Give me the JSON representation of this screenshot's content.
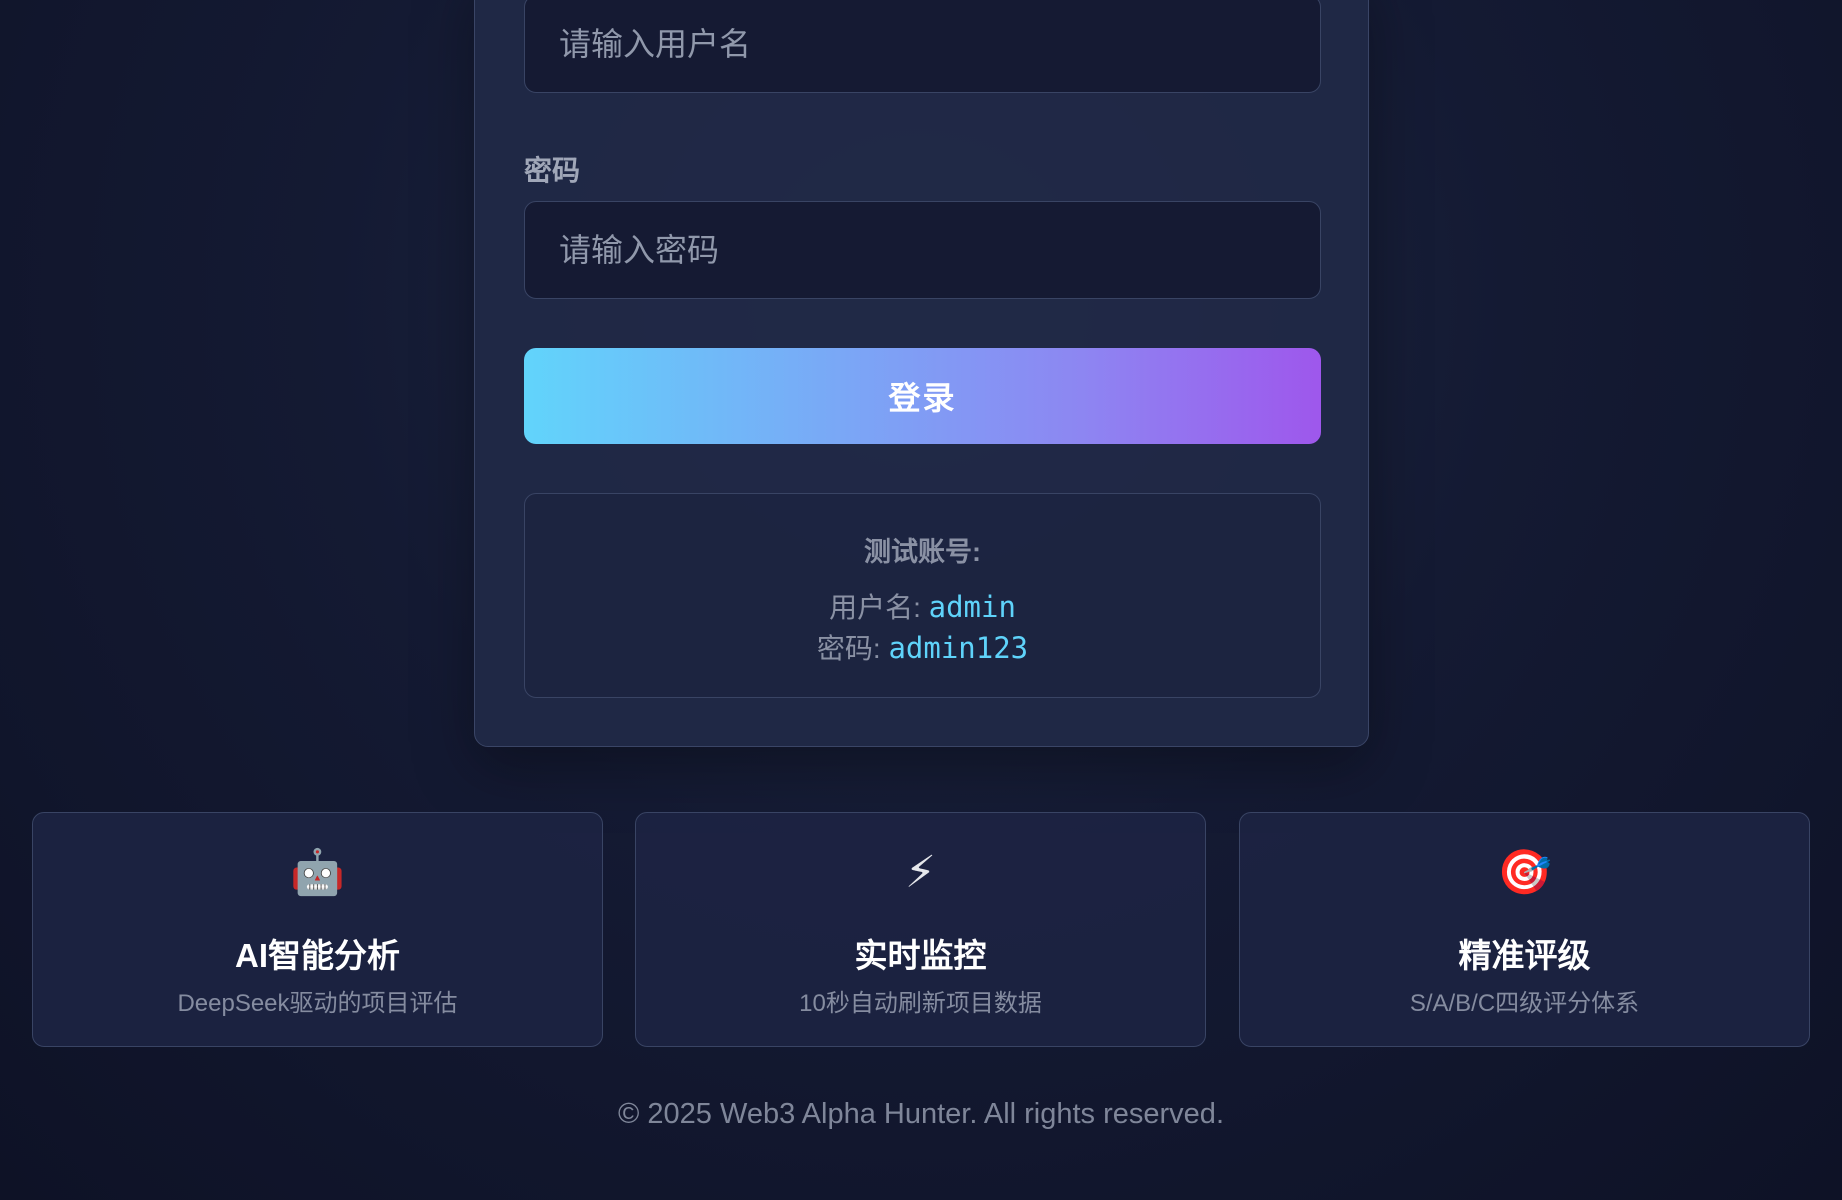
{
  "login": {
    "username_placeholder": "请输入用户名",
    "password_label": "密码",
    "password_placeholder": "请输入密码",
    "login_button": "登录"
  },
  "test_account": {
    "title": "测试账号:",
    "username_label": "用户名: ",
    "username_value": "admin",
    "password_label": "密码: ",
    "password_value": "admin123"
  },
  "features": [
    {
      "icon": "🤖",
      "icon_name": "robot-icon",
      "title": "AI智能分析",
      "desc": "DeepSeek驱动的项目评估"
    },
    {
      "icon": "⚡",
      "icon_name": "lightning-icon",
      "title": "实时监控",
      "desc": "10秒自动刷新项目数据"
    },
    {
      "icon": "🎯",
      "icon_name": "target-icon",
      "title": "精准评级",
      "desc": "S/A/B/C四级评分体系"
    }
  ],
  "footer": {
    "copyright": "© 2025 Web3 Alpha Hunter. All rights reserved."
  },
  "colors": {
    "accent_cyan": "#5fd3fa",
    "accent_purple": "#9e57ec",
    "background": "#141a33",
    "card": "#212946"
  }
}
